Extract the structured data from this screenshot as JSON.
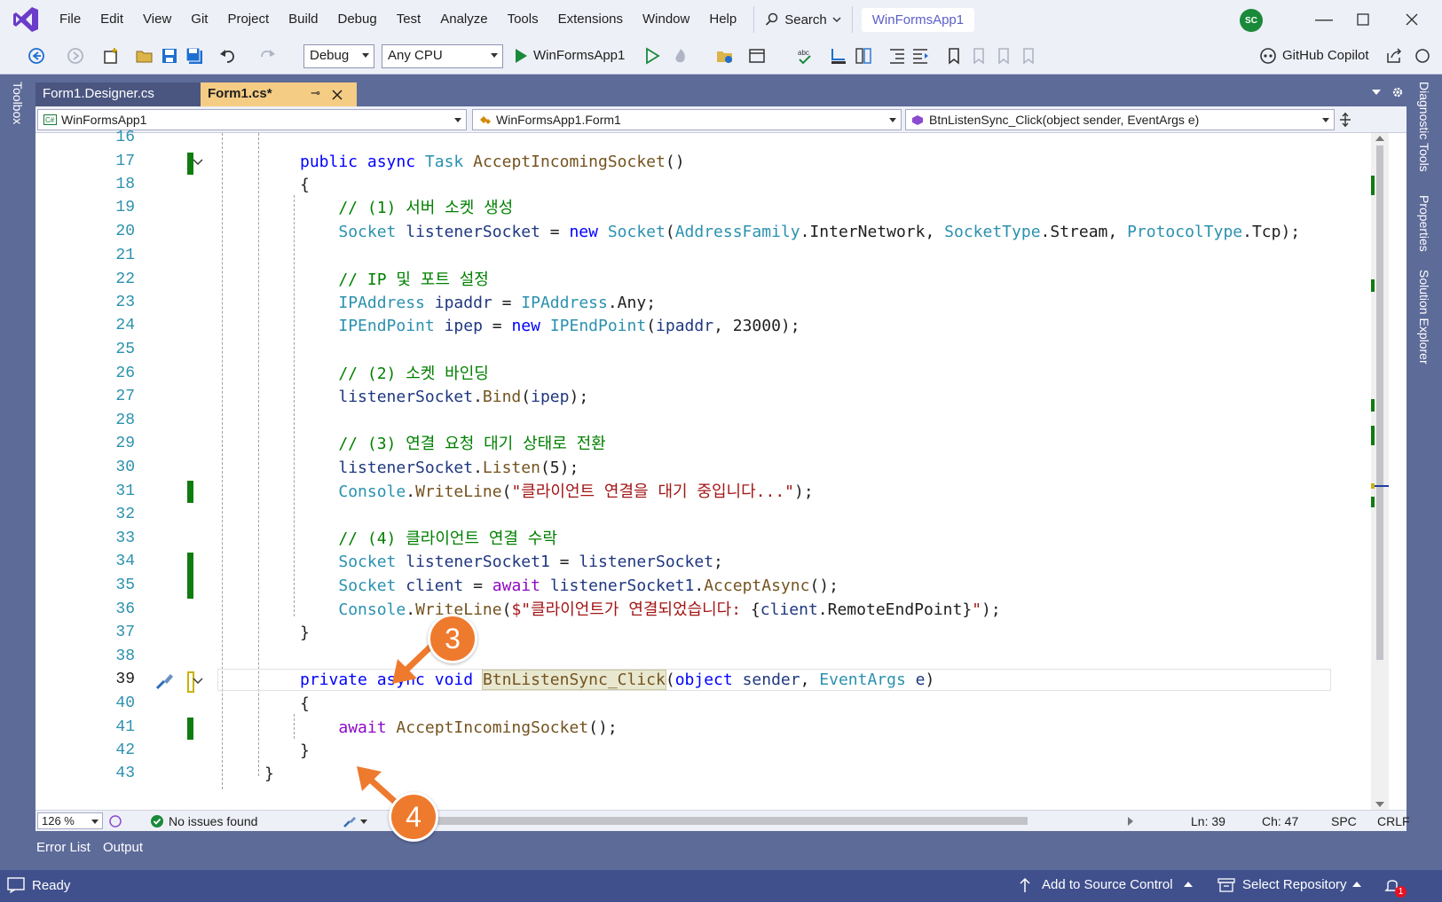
{
  "menu": {
    "items": [
      "File",
      "Edit",
      "View",
      "Git",
      "Project",
      "Build",
      "Debug",
      "Test",
      "Analyze",
      "Tools",
      "Extensions",
      "Window",
      "Help"
    ],
    "search_label": "Search",
    "solution_name": "WinFormsApp1",
    "avatar_initials": "SC"
  },
  "toolbar": {
    "config": "Debug",
    "platform": "Any CPU",
    "start_target": "WinFormsApp1",
    "copilot_label": "GitHub Copilot"
  },
  "side_panels": {
    "left": "Toolbox",
    "right": [
      "Diagnostic Tools",
      "Properties",
      "Solution Explorer"
    ]
  },
  "tabs": [
    {
      "label": "Form1.Designer.cs",
      "active": false
    },
    {
      "label": "Form1.cs*",
      "active": true
    }
  ],
  "navbar": {
    "project": "WinFormsApp1",
    "type": "WinFormsApp1.Form1",
    "member": "BtnListenSync_Click(object sender, EventArgs e)"
  },
  "editor": {
    "line_numbers": [
      "16",
      "17",
      "18",
      "19",
      "20",
      "21",
      "22",
      "23",
      "24",
      "25",
      "26",
      "27",
      "28",
      "29",
      "30",
      "31",
      "32",
      "33",
      "34",
      "35",
      "36",
      "37",
      "38",
      "39",
      "40",
      "41",
      "42",
      "43"
    ],
    "current_line": "39",
    "code_lines": [
      "",
      "public async Task AcceptIncomingSocket()",
      "{",
      "    // (1) 서버 소켓 생성",
      "    Socket listenerSocket = new Socket(AddressFamily.InterNetwork, SocketType.Stream, ProtocolType.Tcp);",
      "",
      "    // IP 및 포트 설정",
      "    IPAddress ipaddr = IPAddress.Any;",
      "    IPEndPoint ipep = new IPEndPoint(ipaddr, 23000);",
      "",
      "    // (2) 소켓 바인딩",
      "    listenerSocket.Bind(ipep);",
      "",
      "    // (3) 연결 요청 대기 상태로 전환",
      "    listenerSocket.Listen(5);",
      "    Console.WriteLine(\"클라이언트 연결을 대기 중입니다...\");",
      "",
      "    // (4) 클라이언트 연결 수락",
      "    Socket listenerSocket1 = listenerSocket;",
      "    Socket client = await listenerSocket1.AcceptAsync();",
      "    Console.WriteLine($\"클라이언트가 연결되었습니다: {client.RemoteEndPoint}\");",
      "}",
      "",
      "private async void BtnListenSync_Click(object sender, EventArgs e)",
      "{",
      "    await AcceptIncomingSocket();",
      "}",
      "}"
    ]
  },
  "editor_status": {
    "zoom": "126 %",
    "issues": "No issues found",
    "line": "Ln: 39",
    "col": "Ch: 47",
    "spc": "SPC",
    "eol": "CRLF"
  },
  "tool_tabs": [
    "Error List",
    "Output"
  ],
  "statusbar": {
    "ready": "Ready",
    "source_control": "Add to Source Control",
    "repository": "Select Repository",
    "notification_count": "1"
  },
  "annotations": [
    "3",
    "4"
  ],
  "colors": {
    "accent": "#5d6b99",
    "keyword": "#0000ff",
    "control_keyword": "#8f08c4",
    "type": "#2b91af",
    "comment": "#008000",
    "string": "#a31515",
    "callout": "#ee7a2e",
    "changed_marker": "#107c10"
  }
}
